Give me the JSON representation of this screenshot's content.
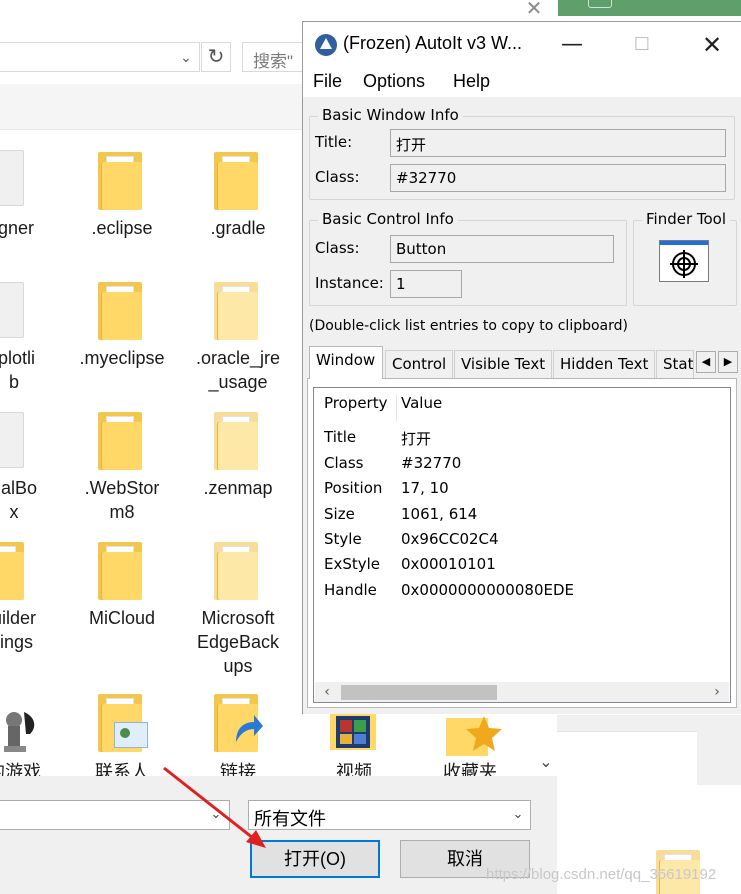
{
  "file_dialog": {
    "search_placeholder": "搜索\"",
    "files": [
      {
        "name": "igner",
        "icon": "document-icon"
      },
      {
        "name": ".eclipse",
        "icon": "folder-icon"
      },
      {
        "name": ".gradle",
        "icon": "folder-icon"
      },
      {
        "name": "tplotli\nb",
        "icon": "document-icon"
      },
      {
        "name": ".myeclipse",
        "icon": "folder-icon"
      },
      {
        "name": ".oracle_jre\n_usage",
        "icon": "folder-icon"
      },
      {
        "name": "ualBo\nx",
        "icon": "document-icon"
      },
      {
        "name": ".WebStor\nm8",
        "icon": "folder-icon"
      },
      {
        "name": ".zenmap",
        "icon": "folder-icon"
      },
      {
        "name": "uilder\ntings",
        "icon": "folder-icon"
      },
      {
        "name": "MiCloud",
        "icon": "folder-icon"
      },
      {
        "name": "Microsoft\nEdgeBack\nups",
        "icon": "folder-icon"
      },
      {
        "name": "的游戏",
        "icon": "games-icon"
      },
      {
        "name": "联系人",
        "icon": "contacts-folder-icon"
      },
      {
        "name": "链接",
        "icon": "links-folder-icon"
      },
      {
        "name": "视频",
        "icon": "videos-folder-icon"
      },
      {
        "name": "收藏夹",
        "icon": "favorites-folder-icon"
      }
    ],
    "filetype": "所有文件",
    "open_button": "打开(O)",
    "cancel_button": "取消",
    "watermark": "https://blog.csdn.net/qq_36619192"
  },
  "autoit": {
    "window_title": "(Frozen) AutoIt v3 W...",
    "menu": {
      "file": "File",
      "options": "Options",
      "help": "Help"
    },
    "basic_window": {
      "legend": "Basic Window Info",
      "title_label": "Title:",
      "title_value": "打开",
      "class_label": "Class:",
      "class_value": "#32770"
    },
    "basic_control": {
      "legend": "Basic Control Info",
      "class_label": "Class:",
      "class_value": "Button",
      "instance_label": "Instance:",
      "instance_value": "1"
    },
    "finder_tool": {
      "legend": "Finder Tool",
      "icon": "crosshair-icon"
    },
    "hint": "(Double-click list entries to copy to clipboard)",
    "tabs": [
      "Window",
      "Control",
      "Visible Text",
      "Hidden Text",
      "Stat"
    ],
    "list": {
      "col_property": "Property",
      "col_value": "Value",
      "rows": [
        {
          "property": "Title",
          "value": "打开"
        },
        {
          "property": "Class",
          "value": "#32770"
        },
        {
          "property": "Position",
          "value": "17, 10"
        },
        {
          "property": "Size",
          "value": "1061, 614"
        },
        {
          "property": "Style",
          "value": "0x96CC02C4"
        },
        {
          "property": "ExStyle",
          "value": "0x00010101"
        },
        {
          "property": "Handle",
          "value": "0x0000000000080EDE"
        }
      ]
    }
  },
  "colors": {
    "accent": "#0078d7",
    "folder": "#ffd867",
    "arrow": "#e02020"
  }
}
